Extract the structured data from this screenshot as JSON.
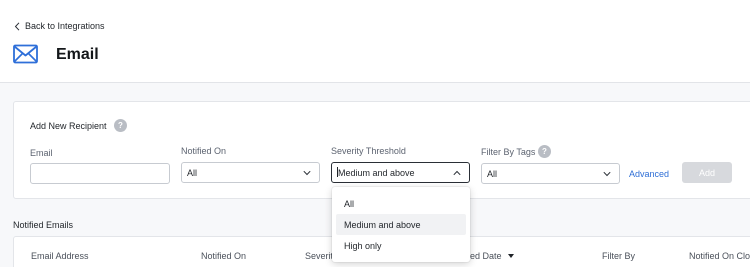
{
  "header": {
    "back_label": "Back to Integrations",
    "title": "Email"
  },
  "form": {
    "title": "Add New Recipient",
    "email_label": "Email",
    "email_value": "",
    "notified_on_label": "Notified On",
    "notified_on_value": "All",
    "severity_label": "Severity Threshold",
    "severity_value": "Medium and above",
    "tags_label": "Filter By Tags",
    "tags_value": "All",
    "advanced_label": "Advanced",
    "add_label": "Add"
  },
  "severity_dropdown": {
    "options": [
      "All",
      "Medium and above",
      "High only"
    ],
    "selected": "Medium and above"
  },
  "list": {
    "title": "Notified Emails",
    "columns": [
      "Email Address",
      "Notified On",
      "Severit",
      "ed Date",
      "Filter By",
      "Notified On Clos"
    ]
  },
  "colors": {
    "accent_link": "#2f6fd6",
    "icon_blue": "#2e6fd9",
    "disabled_button": "#d7d9dd"
  }
}
